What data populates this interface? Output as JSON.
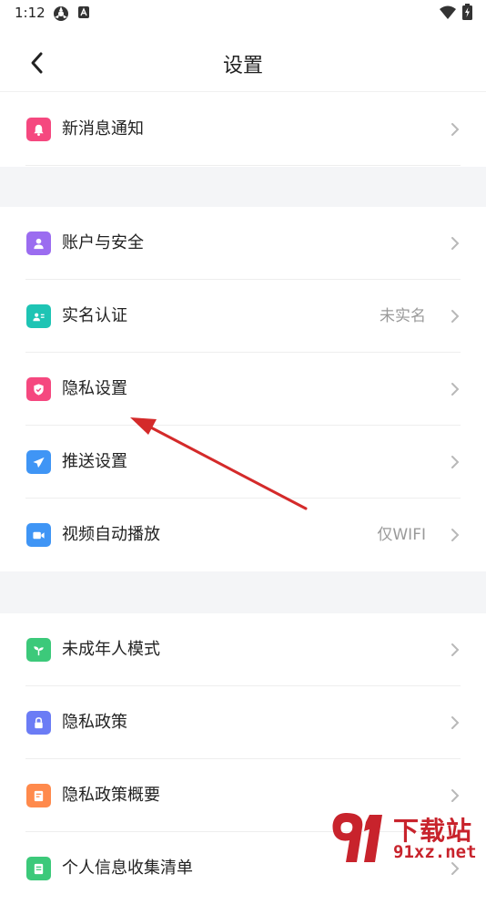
{
  "status_bar": {
    "time": "1:12"
  },
  "header": {
    "title": "设置"
  },
  "groups": [
    {
      "items": [
        {
          "label": "新消息通知",
          "value": "",
          "icon": "bell-icon",
          "color": "#f5487f"
        }
      ]
    },
    {
      "items": [
        {
          "label": "账户与安全",
          "value": "",
          "icon": "user-icon",
          "color": "#9b6cf0"
        },
        {
          "label": "实名认证",
          "value": "未实名",
          "icon": "id-card-icon",
          "color": "#1ec4b4"
        },
        {
          "label": "隐私设置",
          "value": "",
          "icon": "shield-icon",
          "color": "#f5487f"
        },
        {
          "label": "推送设置",
          "value": "",
          "icon": "send-icon",
          "color": "#3f95f5"
        },
        {
          "label": "视频自动播放",
          "value": "仅WIFI",
          "icon": "video-icon",
          "color": "#3f95f5"
        }
      ]
    },
    {
      "items": [
        {
          "label": "未成年人模式",
          "value": "",
          "icon": "sprout-icon",
          "color": "#3cc97a"
        },
        {
          "label": "隐私政策",
          "value": "",
          "icon": "lock-icon",
          "color": "#6b7cf5"
        },
        {
          "label": "隐私政策概要",
          "value": "",
          "icon": "document-icon",
          "color": "#ff8a4c"
        },
        {
          "label": "个人信息收集清单",
          "value": "",
          "icon": "list-icon",
          "color": "#3cc97a"
        }
      ]
    }
  ],
  "watermark": {
    "main": "下载站",
    "sub": "91xz.net"
  },
  "colors": {
    "gap_background": "#f4f5f7",
    "annotation_arrow": "#d42a2a",
    "chevron": "#b8b8b8",
    "value_text": "#9a9a9a"
  }
}
